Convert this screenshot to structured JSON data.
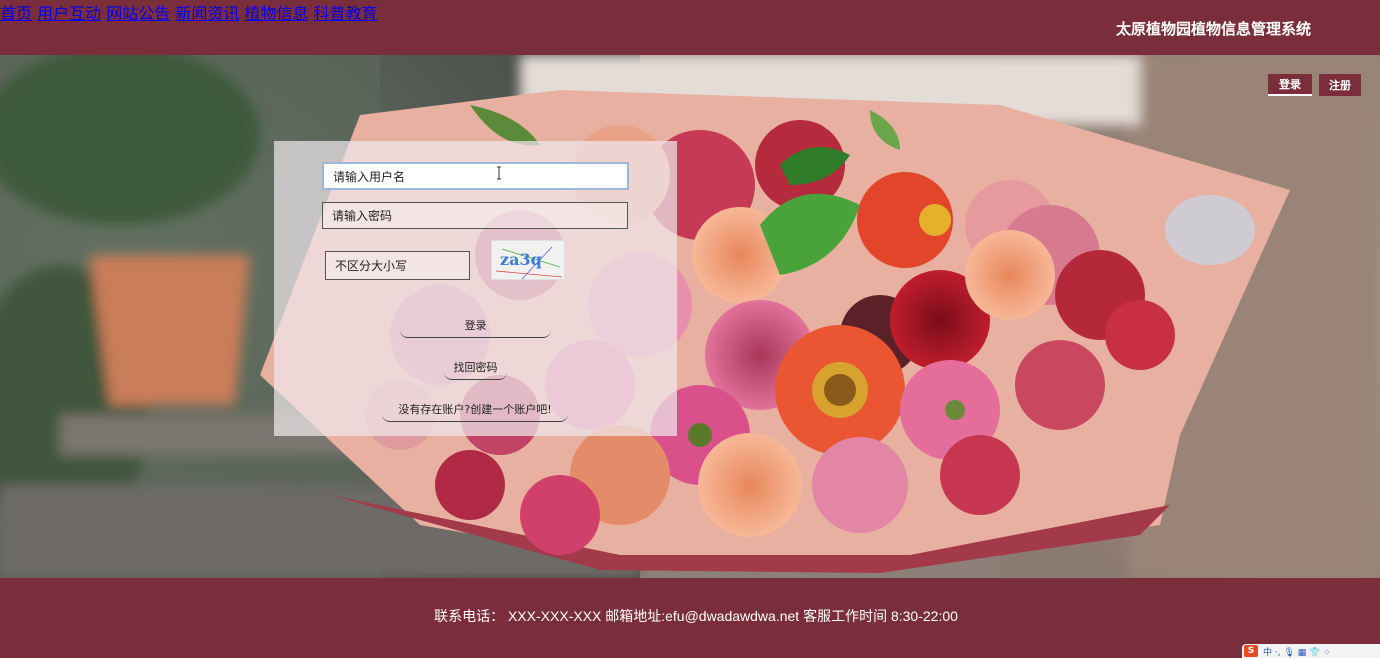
{
  "nav": {
    "items": [
      {
        "label": "首页"
      },
      {
        "label": "用户互动"
      },
      {
        "label": "网站公告"
      },
      {
        "label": "新闻资讯"
      },
      {
        "label": "植物信息"
      },
      {
        "label": "科普教育"
      }
    ],
    "site_title": "太原植物园植物信息管理系统"
  },
  "auth": {
    "login_label": "登录",
    "register_label": "注册"
  },
  "login_form": {
    "username_placeholder": "请输入用户名",
    "password_placeholder": "请输入密码",
    "captcha_placeholder": "不区分大小写",
    "captcha_text": "za3q",
    "submit_label": "登录",
    "forgot_label": "找回密码",
    "create_label": "没有存在账户?创建一个账户吧!"
  },
  "footer": {
    "text": "联系电话： XXX-XXX-XXX 邮箱地址:efu@dwadawdwa.net 客服工作时间 8:30-22:00"
  },
  "ime": {
    "logo": "S",
    "glyphs": "中 ·, 🎙 ▦ 👕 ⁘"
  },
  "colors": {
    "brand": "#7a2e3b",
    "panel": "#eee8ec",
    "focus_border": "#9fb6d8"
  }
}
